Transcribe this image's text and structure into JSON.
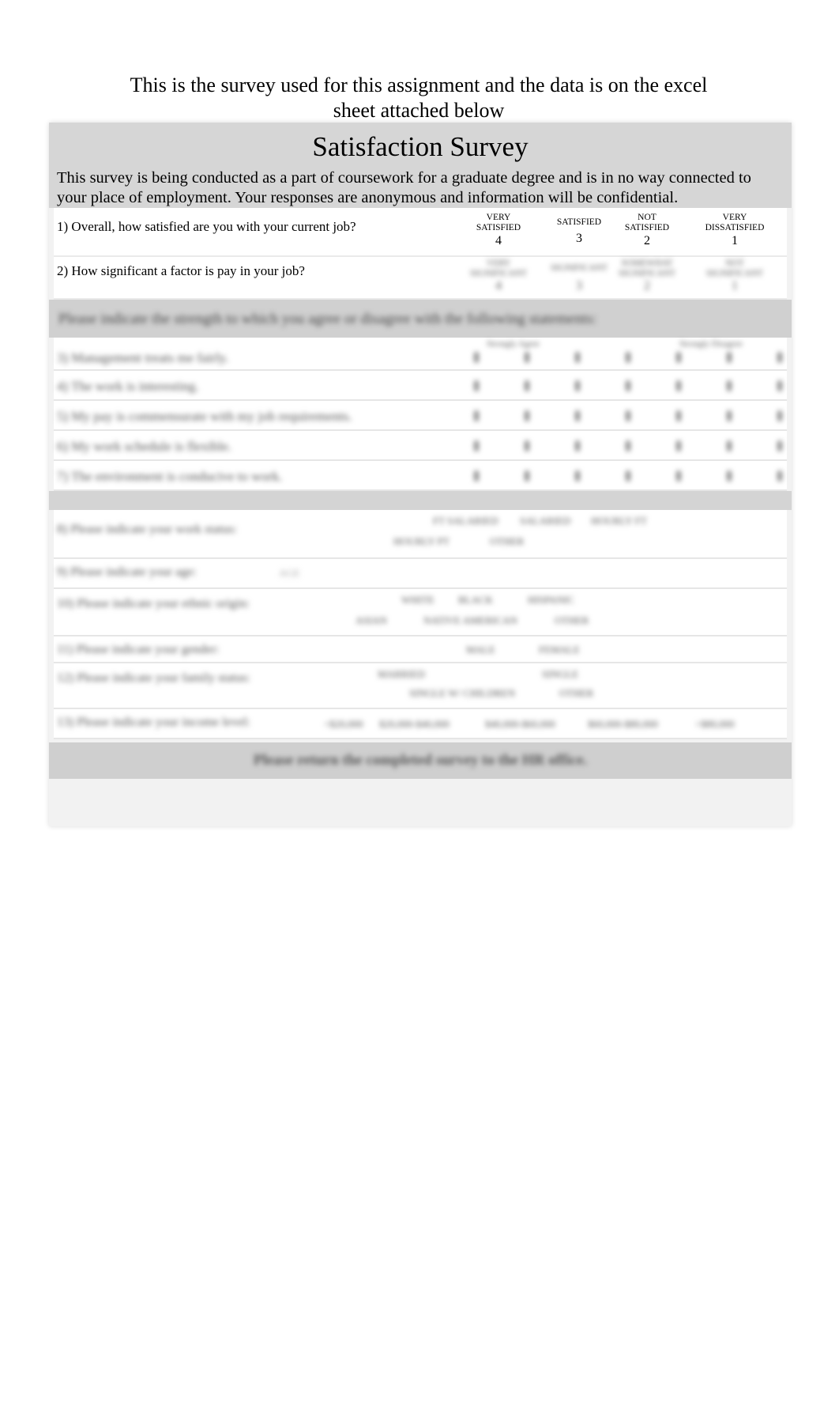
{
  "intro": {
    "line1": "This is the survey used for this assignment and the data is on the excel",
    "line2": "sheet attached below"
  },
  "survey": {
    "title": "Satisfaction Survey",
    "description_line1": "This survey is being conducted as a part of coursework for a graduate degree and is in no way connected to",
    "description_line2": "your place of employment.  Your responses are anonymous and information will be confidential."
  },
  "questions": [
    {
      "text": "1) Overall, how satisfied are you with your current job?",
      "options": [
        {
          "label_top": "VERY",
          "label_bottom": "SATISFIED",
          "value": "4"
        },
        {
          "label_top": "",
          "label_bottom": "SATISFIED",
          "value": "3"
        },
        {
          "label_top": "NOT",
          "label_bottom": "SATISFIED",
          "value": "2"
        },
        {
          "label_top": "VERY",
          "label_bottom": "DISSATISFIED",
          "value": "1"
        }
      ]
    },
    {
      "text": "2) How significant a factor is pay in your job?",
      "options": [
        {
          "label_top": "VERY",
          "label_bottom": "SIGNIFICANT",
          "value": "4"
        },
        {
          "label_top": "",
          "label_bottom": "SIGNIFICANT",
          "value": "3"
        },
        {
          "label_top": "SOMEWHAT",
          "label_bottom": "SIGNIFICANT",
          "value": "2"
        },
        {
          "label_top": "NOT",
          "label_bottom": "SIGNIFICANT",
          "value": "1"
        }
      ]
    }
  ],
  "obscured": {
    "likert_header": "Please indicate the strength to which you agree or disagree with the following statements:",
    "likert_scale_left": "Strongly Agree",
    "likert_scale_right": "Strongly Disagree",
    "likert_items": [
      "3) Management treats me fairly.",
      "4) The work is interesting.",
      "5) My pay is commensurate with my job requirements.",
      "6) My work schedule is flexible.",
      "7) The environment is conducive to work."
    ],
    "demographics": [
      {
        "text": "8) Please indicate your work status:",
        "options": [
          "FT SALARIED",
          "SALARIED",
          "HOURLY FT",
          "HOURLY PT",
          "OTHER"
        ]
      },
      {
        "text": "9) Please indicate your age:",
        "options": [
          "AGE"
        ]
      },
      {
        "text": "10) Please indicate your ethnic origin:",
        "options": [
          "WHITE",
          "BLACK",
          "HISPANIC",
          "ASIAN",
          "NATIVE AMERICAN",
          "OTHER"
        ]
      },
      {
        "text": "11) Please indicate your gender:",
        "options": [
          "MALE",
          "FEMALE"
        ]
      },
      {
        "text": "12) Please indicate your family status:",
        "options": [
          "MARRIED",
          "SINGLE",
          "SINGLE W/ CHILDREN",
          "OTHER"
        ]
      },
      {
        "text": "13) Please indicate your income level:",
        "options": [
          "<$20,000",
          "$20,000-$40,000",
          "$40,000-$60,000",
          "$60,000-$80,000",
          ">$80,000"
        ]
      }
    ],
    "footer": "Please return the completed survey to the HR office."
  }
}
